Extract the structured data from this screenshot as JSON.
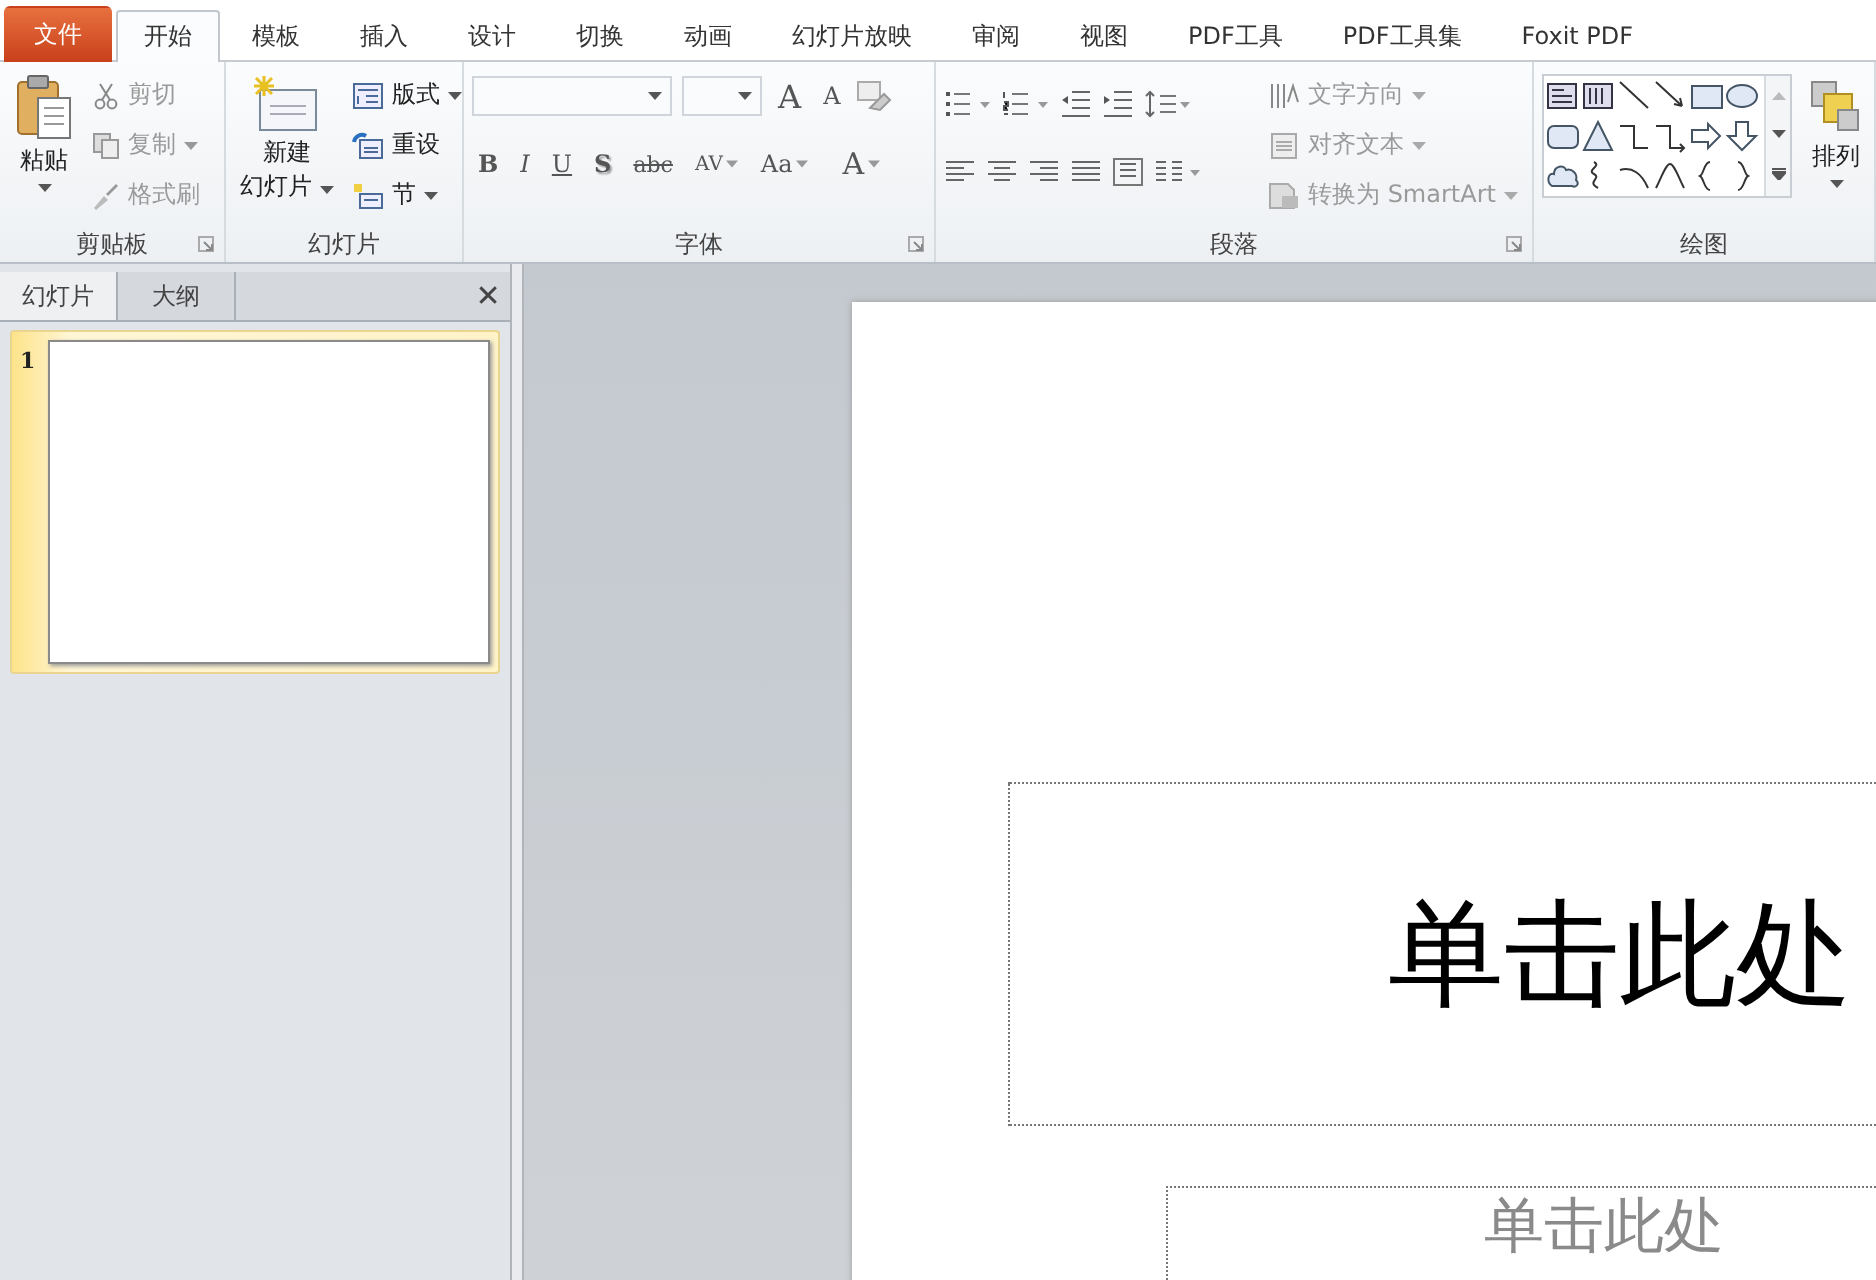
{
  "tabs": [
    {
      "label": "文件",
      "kind": "file",
      "selected": false
    },
    {
      "label": "开始",
      "kind": "tab",
      "selected": true
    },
    {
      "label": "模板",
      "kind": "tab",
      "selected": false
    },
    {
      "label": "插入",
      "kind": "tab",
      "selected": false
    },
    {
      "label": "设计",
      "kind": "tab",
      "selected": false
    },
    {
      "label": "切换",
      "kind": "tab",
      "selected": false
    },
    {
      "label": "动画",
      "kind": "tab",
      "selected": false
    },
    {
      "label": "幻灯片放映",
      "kind": "tab",
      "selected": false
    },
    {
      "label": "审阅",
      "kind": "tab",
      "selected": false
    },
    {
      "label": "视图",
      "kind": "tab",
      "selected": false
    },
    {
      "label": "PDF工具",
      "kind": "tab",
      "selected": false
    },
    {
      "label": "PDF工具集",
      "kind": "tab",
      "selected": false
    },
    {
      "label": "Foxit PDF",
      "kind": "tab",
      "selected": false
    }
  ],
  "clipboard": {
    "label": "剪贴板",
    "paste": "粘贴",
    "items": [
      {
        "label": "剪切",
        "kind": "cut",
        "disabled": true,
        "menu": false
      },
      {
        "label": "复制",
        "kind": "copy",
        "disabled": true,
        "menu": true
      },
      {
        "label": "格式刷",
        "kind": "brush",
        "disabled": true,
        "menu": false
      }
    ]
  },
  "slides_group": {
    "label": "幻灯片",
    "new_slide": [
      "新建",
      "幻灯片"
    ],
    "items": [
      {
        "label": "版式",
        "kind": "layout",
        "disabled": false,
        "menu": true
      },
      {
        "label": "重设",
        "kind": "reset",
        "disabled": false,
        "menu": false
      },
      {
        "label": "节",
        "kind": "section",
        "disabled": false,
        "menu": true
      }
    ]
  },
  "font": {
    "label": "字体",
    "buttons": [
      {
        "text": "B",
        "kind": "bold",
        "menu": false
      },
      {
        "text": "I",
        "kind": "italic",
        "menu": false
      },
      {
        "text": "U",
        "kind": "underline",
        "menu": false
      },
      {
        "text": "S",
        "kind": "shadow",
        "menu": false
      },
      {
        "text": "abc",
        "kind": "strike",
        "menu": false
      },
      {
        "text": "AV",
        "kind": "spacing",
        "menu": true
      },
      {
        "text": "Aa",
        "kind": "case",
        "menu": true
      },
      {
        "text": "A",
        "kind": "color",
        "menu": true
      }
    ],
    "grow": "A",
    "shrink": "A"
  },
  "paragraph": {
    "label": "段落",
    "commands": [
      {
        "label": "文字方向",
        "kind": "direction",
        "disabled": true
      },
      {
        "label": "对齐文本",
        "kind": "align",
        "disabled": true
      },
      {
        "label": "转换为 SmartArt",
        "kind": "smartart",
        "disabled": true
      }
    ]
  },
  "drawing": {
    "label": "绘图",
    "arrange": "排列"
  },
  "panel": {
    "tabs": [
      {
        "label": "幻灯片",
        "selected": true
      },
      {
        "label": "大纲",
        "selected": false
      }
    ],
    "close": "✕",
    "thumbnails": [
      {
        "number": "1",
        "selected": true
      }
    ]
  },
  "slide": {
    "title": "单击此处",
    "subtitle": "单击此处"
  }
}
